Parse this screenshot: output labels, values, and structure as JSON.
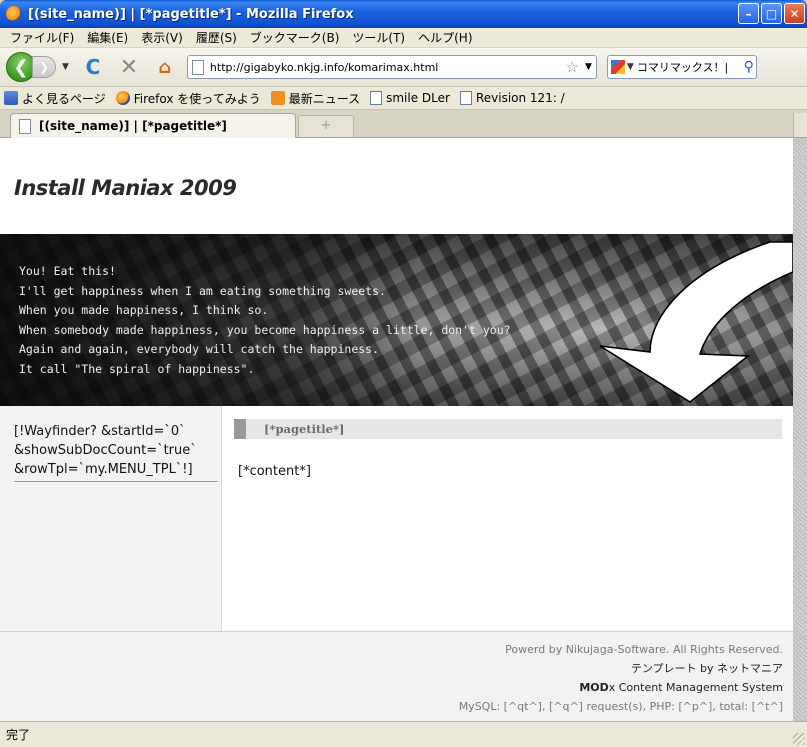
{
  "window": {
    "title": "[(site_name)] | [*pagetitle*] - Mozilla Firefox",
    "minimize": "–",
    "maximize": "□",
    "close": "✕"
  },
  "menu": [
    "ファイル(F)",
    "編集(E)",
    "表示(V)",
    "履歴(S)",
    "ブックマーク(B)",
    "ツール(T)",
    "ヘルプ(H)"
  ],
  "nav": {
    "url": "http://gigabyko.nkjg.info/komarimax.html",
    "search_value": "コマリマックス！|",
    "icons": [
      "back-icon",
      "forward-icon",
      "reload-icon",
      "stop-icon",
      "home-icon",
      "star-icon",
      "search-icon"
    ]
  },
  "bookmarks": [
    {
      "label": "よく見るページ",
      "icon": "most-visited-icon"
    },
    {
      "label": "Firefox を使ってみよう",
      "icon": "firefox-icon"
    },
    {
      "label": "最新ニュース",
      "icon": "rss-icon"
    },
    {
      "label": "smile DLer",
      "icon": "page-icon"
    },
    {
      "label": "Revision 121: /",
      "icon": "page-icon"
    }
  ],
  "tab": {
    "title": "[(site_name)] | [*pagetitle*]",
    "new_tab": "+"
  },
  "site": {
    "title": "Install Maniax 2009",
    "banner_lines": [
      "You! Eat this!",
      "I'll get happiness when I am eating something sweets.",
      "When you made happiness, I think so.",
      "When somebody made happiness, you become happiness a little, don't you?",
      "Again and again, everybody will catch the happiness.",
      "It call \"The spiral of happiness\"."
    ],
    "wayfinder": "[!Wayfinder? &startId=`0` &showSubDocCount=`true` &rowTpl=`my.MENU_TPL`!]",
    "pagetitle": "[*pagetitle*]",
    "content": "[*content*]",
    "footer": {
      "line1": "Powerd by Nikujaga-Software. All Rights Reserved.",
      "line2": "テンプレート by ネットマニア",
      "line3_bold": "MOD",
      "line3_rest": "x Content Management System",
      "line4": "MySQL: [^qt^], [^q^] request(s), PHP: [^p^], total: [^t^]"
    }
  },
  "status": "完了",
  "colors": {
    "titlebar": "#1b63e0",
    "accent_green": "#3a9a20"
  }
}
